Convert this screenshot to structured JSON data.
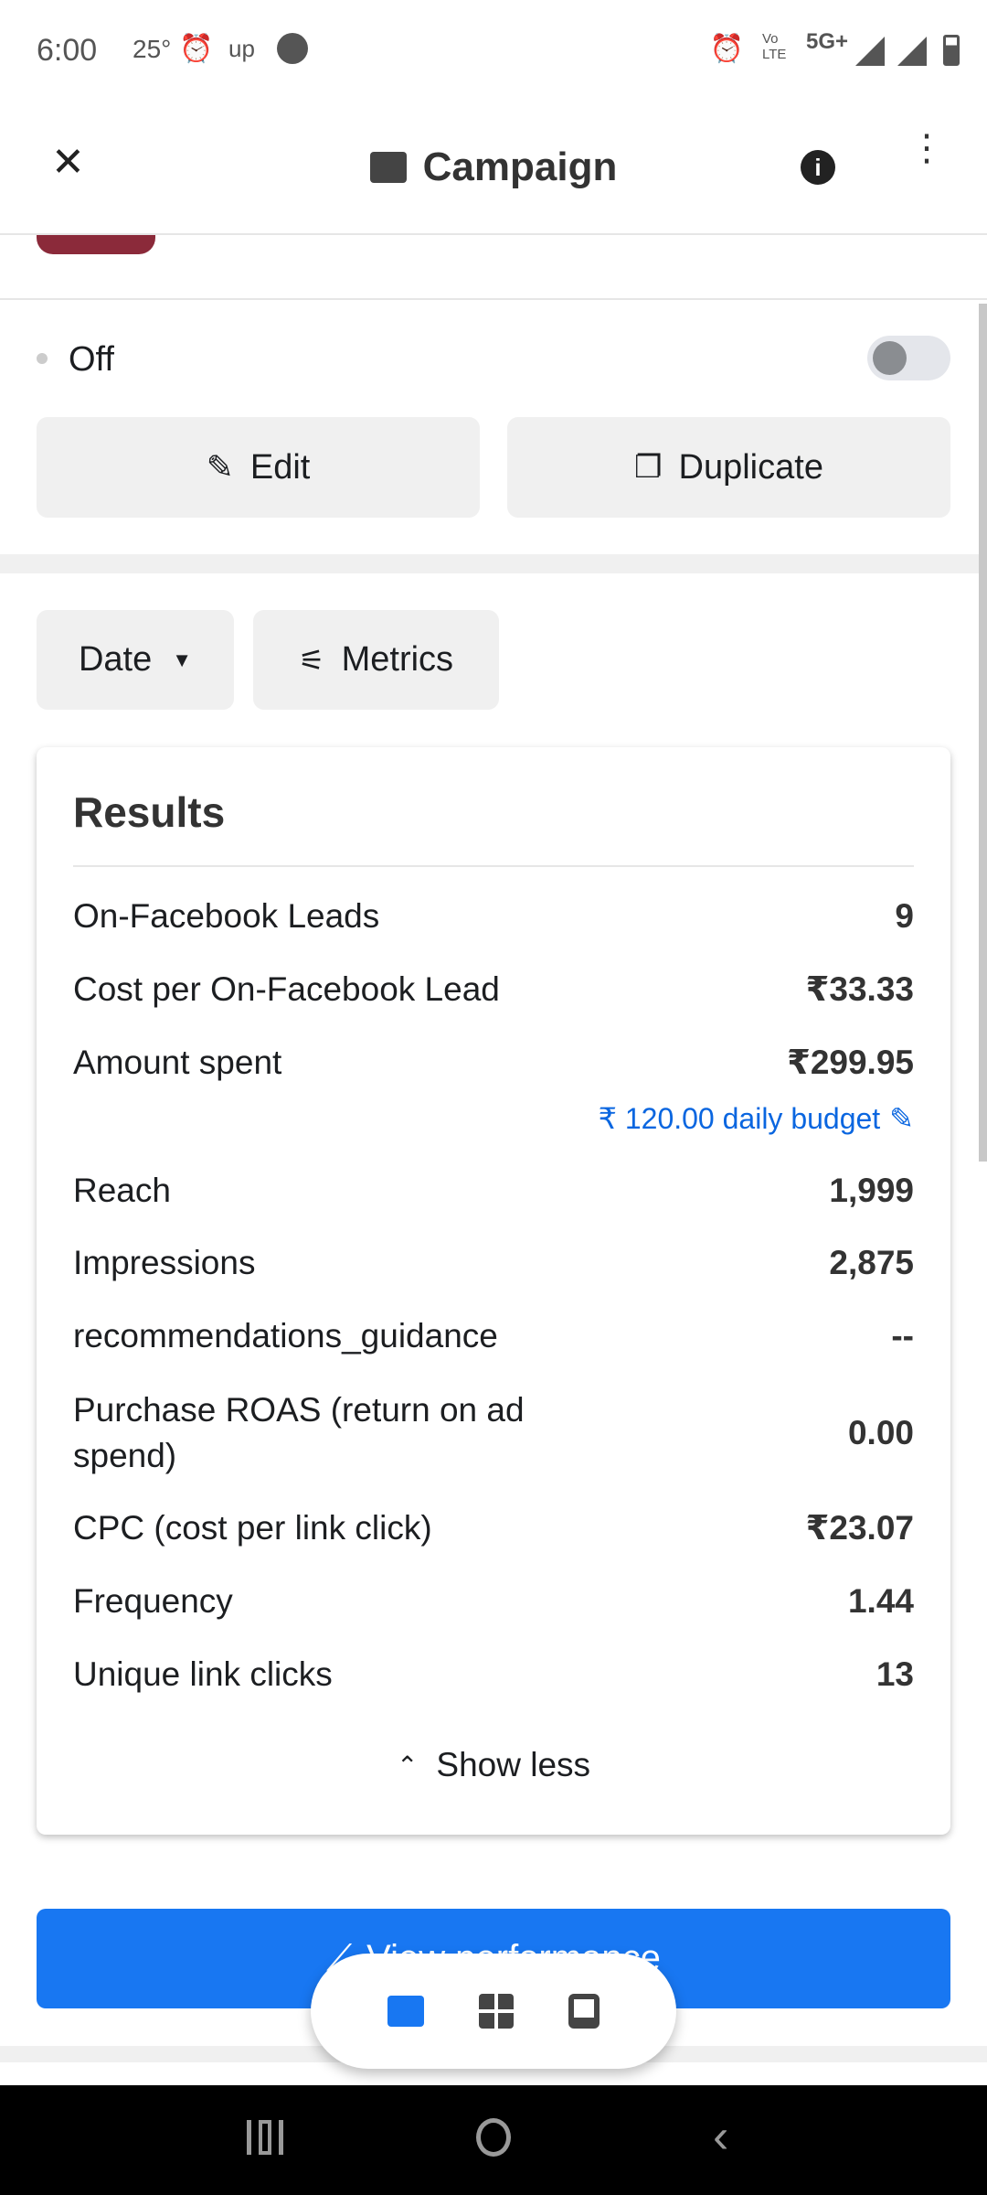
{
  "status_bar": {
    "time": "6:00",
    "temp": "25°",
    "carrier_icon": "up",
    "network": "5G+",
    "volte": "Vo LTE"
  },
  "header": {
    "title": "Campaign",
    "folder_icon": "folder-icon",
    "info_icon": "info-icon",
    "more_icon": "more-vert-icon"
  },
  "campaign": {
    "status": "Off",
    "toggle_on": false
  },
  "actions": {
    "edit": "Edit",
    "duplicate": "Duplicate"
  },
  "filters": {
    "date": "Date",
    "metrics": "Metrics"
  },
  "results": {
    "title": "Results",
    "rows": [
      {
        "label": "On-Facebook Leads",
        "value": "9"
      },
      {
        "label": "Cost per On-Facebook Lead",
        "value": "₹33.33"
      },
      {
        "label": "Amount spent",
        "value": "₹299.95"
      },
      {
        "label": "Reach",
        "value": "1,999"
      },
      {
        "label": "Impressions",
        "value": "2,875"
      },
      {
        "label": "recommendations_guidance",
        "value": "--"
      },
      {
        "label": "Purchase ROAS (return on ad spend)",
        "value": "0.00"
      },
      {
        "label": "CPC (cost per link click)",
        "value": "₹23.07"
      },
      {
        "label": "Frequency",
        "value": "1.44"
      },
      {
        "label": "Unique link clicks",
        "value": "13"
      }
    ],
    "budget": "₹ 120.00 daily budget",
    "show_less": "Show less"
  },
  "view_performance": "View performance",
  "colors": {
    "accent": "#1877f2",
    "link": "#0a66e0"
  }
}
